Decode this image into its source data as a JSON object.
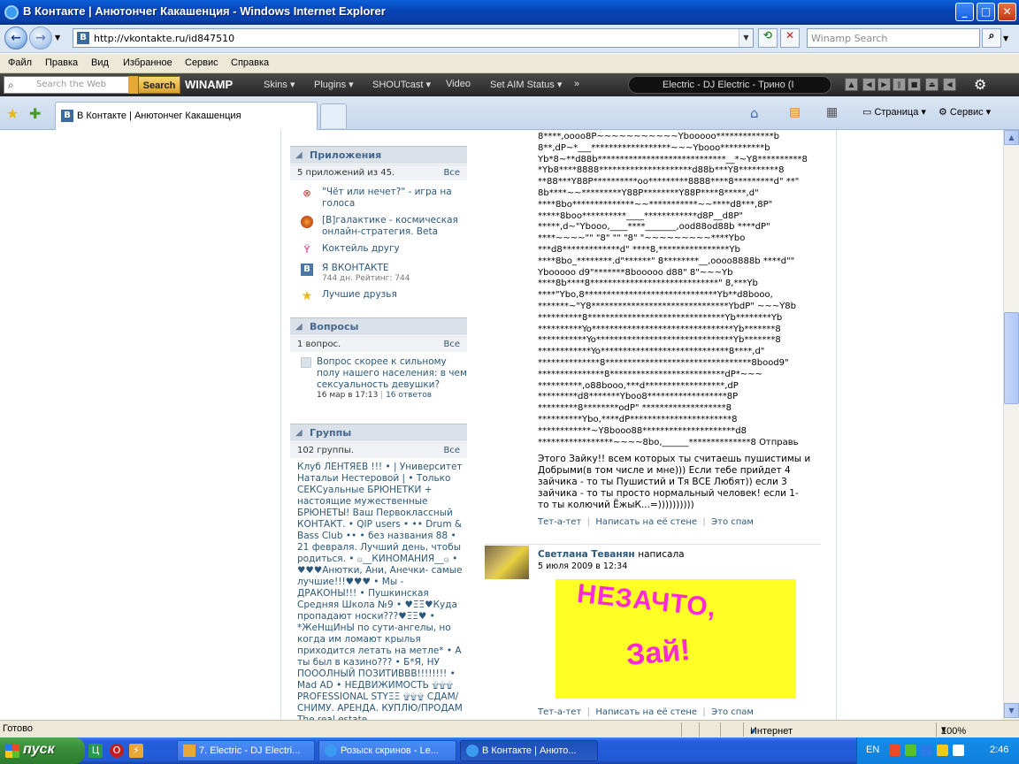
{
  "window": {
    "title": "В Контакте | Анютончег Какашенция - Windows Internet Explorer",
    "minimize": "_",
    "maximize": "□",
    "close": "✕"
  },
  "address": {
    "url": "http://vkontakte.ru/id847510",
    "winamp_search_placeholder": "Winamp Search"
  },
  "menu": [
    "Файл",
    "Правка",
    "Вид",
    "Избранное",
    "Сервис",
    "Справка"
  ],
  "winamp": {
    "search_placeholder": "Search the Web",
    "search_button": "Search",
    "logo": "WINAMP",
    "items": [
      "Skins ▾",
      "Plugins ▾",
      "SHOUTcast ▾",
      "Video",
      "Set AIM Status ▾",
      "»"
    ],
    "track": "Electric - DJ Electric - Трино (I"
  },
  "tabs": {
    "active": "В Контакте | Анютончег Какашенция",
    "page_menu": "Страница",
    "tools_menu": "Сервис"
  },
  "sidebar": {
    "apps": {
      "title": "Приложения",
      "count": "5 приложений из 45.",
      "all": "Все",
      "items": [
        {
          "label": "\"Чёт или нечет?\" - игра на голоса",
          "icon": "rings-icon"
        },
        {
          "label": "[В]галактике - космическая онлайн-стратегия. Beta",
          "icon": "planet-icon"
        },
        {
          "label": "Коктейль другу",
          "icon": "cocktail-icon"
        },
        {
          "label": "Я ВКОНТАКТЕ",
          "meta": "744 дн. Рейтинг: 744",
          "icon": "vk-icon"
        },
        {
          "label": "Лучшие друзья",
          "icon": "star-icon"
        }
      ]
    },
    "questions": {
      "title": "Вопросы",
      "count": "1 вопрос.",
      "all": "Все",
      "item": "Вопрос скорее к сильному полу нашего населения: в чем сексуальность девушки?",
      "date": "16 мар в 17:13",
      "answers": "16 ответов"
    },
    "groups": {
      "title": "Группы",
      "count": "102 группы.",
      "all": "Все",
      "text": "Клуб ЛЕНТЯЕВ !!! • | Университет Натальи Нестеровой | • Только СЕКСуальные БРЮНЕТКИ + настоящие мужественные БРЮНЕТЫ! Ваш Первоклассный КОНТАКТ. • QIP users • •• Drum & Bass Club •• • без названия 88 • 21 февраля. Лучший день, чтобы родиться. • ۞__КИНОМАНИЯ__۞ • ♥♥♥Анютки, Ани, Анечки- самые лучшие!!!♥♥♥ • Мы - ДРАКОНЫ!!! • Пушкинская Средняя Школа №9 • ♥ΞΞ♥Куда пропадают носки???♥ΞΞ♥ • *ЖеНщИнЫ по сути-ангелы, но когда им ломают крылья приходится летать на метле* • А ты был в казино??? • Б*Я, НУ ПОООЛНЫЙ ПОЗИТИВВВ!!!!!!!! • Mad AD • НЕДВИЖИМОСТЬ ۩۩۩ PROFESSIONAL STYΞΞ ۩۩۩ СДАМ/СНИМУ. АРЕНДА. КУПЛЮ/ПРОДАМ The real estate"
    }
  },
  "wall": {
    "ascii": "8****,oooo8P~~~~~~~~~~~Ybooooo*************b\n8**,dP~*___******************~~~Ybooo**********b\nYb*8~**d88b*****************************__*~Y8**********8\n*Yb8****8888*********************d88b***Y8*********8\n**88***Y88P**********oo*********8888****8*********d\" **\"\n8b****~~*********Y88P********Y88P****8*****,d\"\n****8bo**************~~***********~~****d8***,8P\"\n*****8boo**********____************d8P__d8P\"\n*****,d~\"Ybooo,____****_______,ood88od88b ****dP\"\n****~~~~\"\" \"8\" \"\" \"8\" \"~~~~~~~~~****Ybo\n***d8*************d\" ****8,****************Yb\n****8bo_********.d\"******\" 8********__,oooo8888b ****d\"\"\nYbooooo d9\"*******8booooo d88\" 8\"~~~Yb\n****8b****8*****************************\" 8,***Yb\n****\"Ybo,8******************************Yb**d8booo,\n*******~\"Y8*******************************YbdP\" ~~~Y8b\n**********8*******************************Yb********Yb\n**********Yo********************************Yb*******8\n***********Yo*******************************Yb*******8\n************Yo*****************************8****,d\"\n**************8*********************************8bood9\"\n***************8**************************dP*~~~\n**********,o88booo,***d******************,dP\n*********d8*******Yboo8******************8P\n*********8********odP\" *******************8\n**********Ybo,****dP***********************8\n************~Y8booo88*********************d8\n*****************~~~~8bo,______**************8 Отправь",
    "post1_text": "Этого Зайку!! всем которых ты считаешь пушистимы и Добрыми(в том числе и мне))) Если тебе прийдет 4 зайчика - то ты Пушистий и Тя ВСЕ Любят)) если 3 зайчика - то ты просто нормальный человек! если 1- то ты колючий ЁжыК...=))))))))))",
    "actions": [
      "Тет-а-тет",
      "Написать на её стене",
      "Это спам"
    ],
    "post2": {
      "author": "Светлана Теванян",
      "wrote": "написала",
      "date": "5 июля 2009 в 12:34",
      "image_line1": "НЕЗАЧТО,",
      "image_line2": "Зай!"
    }
  },
  "status": {
    "left": "Готово",
    "zone": "Интернет",
    "zoom": "100%"
  },
  "taskbar": {
    "start": "пуск",
    "tasks": [
      "7. Electric - DJ Electri...",
      "Розыск скринов - Le...",
      "В Контакте | Анюто..."
    ],
    "lang": "EN",
    "time": "2:46"
  }
}
